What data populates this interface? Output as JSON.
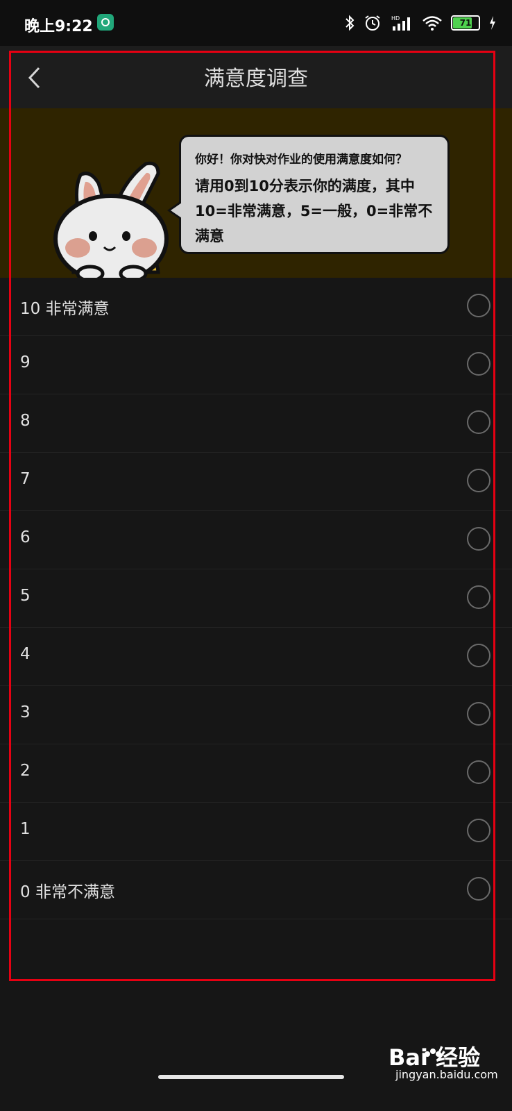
{
  "status_bar": {
    "time": "晚上9:22",
    "signal_label": "HD",
    "battery_level": "71",
    "icons": [
      "bluetooth-icon",
      "alarm-icon",
      "signal-icon",
      "wifi-icon",
      "battery-icon",
      "charging-icon"
    ]
  },
  "header": {
    "title": "满意度调查",
    "back_icon": "chevron-left-icon"
  },
  "banner": {
    "greeting": "你好！你对快对作业的使用满意度如何？",
    "instruction": "请用0到10分表示你的满度，其中10=非常满意，5=一般，0=非常不满意",
    "mascot": "rabbit-mascot"
  },
  "options": [
    {
      "label": "10 非常满意"
    },
    {
      "label": "9"
    },
    {
      "label": "8"
    },
    {
      "label": "7"
    },
    {
      "label": "6"
    },
    {
      "label": "5"
    },
    {
      "label": "4"
    },
    {
      "label": "3"
    },
    {
      "label": "2"
    },
    {
      "label": "1"
    },
    {
      "label": "0 非常不满意"
    }
  ],
  "watermark": {
    "brand": "Bai 经验",
    "url": "jingyan.baidu.com"
  },
  "colors": {
    "background": "#161616",
    "header": "#1d1d1d",
    "banner": "#2f2400",
    "bubble": "#d2d2d2",
    "highlight_frame": "#e60012"
  }
}
